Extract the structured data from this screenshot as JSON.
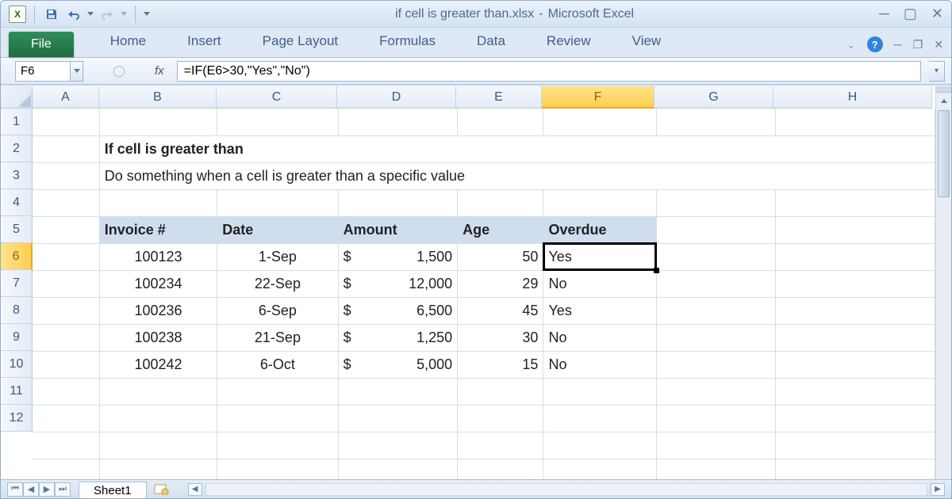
{
  "title": {
    "doc": "if cell is greater than.xlsx",
    "sep": " - ",
    "app": "Microsoft Excel"
  },
  "ribbon": {
    "file": "File",
    "tabs": [
      "Home",
      "Insert",
      "Page Layout",
      "Formulas",
      "Data",
      "Review",
      "View"
    ]
  },
  "namebox": "F6",
  "formula": "=IF(E6>30,\"Yes\",\"No\")",
  "fx": "fx",
  "columns": [
    "A",
    "B",
    "C",
    "D",
    "E",
    "F",
    "G",
    "H"
  ],
  "selected_col": "F",
  "rows": [
    "1",
    "2",
    "3",
    "4",
    "5",
    "6",
    "7",
    "8",
    "9",
    "10",
    "11",
    "12"
  ],
  "selected_row": "6",
  "content": {
    "title": "If cell is greater than",
    "subtitle": "Do something when a cell is greater than a specific value",
    "headers": {
      "invoice": "Invoice #",
      "date": "Date",
      "amount": "Amount",
      "age": "Age",
      "overdue": "Overdue"
    },
    "rows": [
      {
        "invoice": "100123",
        "date": "1-Sep",
        "amount": "1,500",
        "age": "50",
        "overdue": "Yes"
      },
      {
        "invoice": "100234",
        "date": "22-Sep",
        "amount": "12,000",
        "age": "29",
        "overdue": "No"
      },
      {
        "invoice": "100236",
        "date": "6-Sep",
        "amount": "6,500",
        "age": "45",
        "overdue": "Yes"
      },
      {
        "invoice": "100238",
        "date": "21-Sep",
        "amount": "1,250",
        "age": "30",
        "overdue": "No"
      },
      {
        "invoice": "100242",
        "date": "6-Oct",
        "amount": "5,000",
        "age": "15",
        "overdue": "No"
      }
    ],
    "currency": "$"
  },
  "sheet_tab": "Sheet1"
}
